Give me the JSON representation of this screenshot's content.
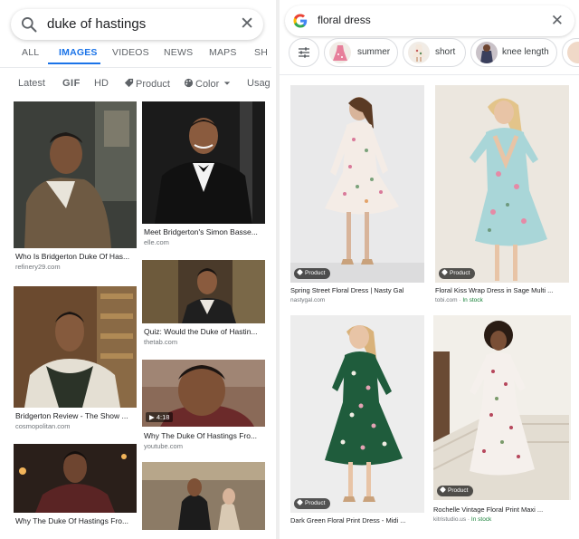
{
  "left": {
    "search": {
      "query": "duke of hastings"
    },
    "tabs": [
      {
        "label": "ALL"
      },
      {
        "label": "IMAGES"
      },
      {
        "label": "VIDEOS"
      },
      {
        "label": "NEWS"
      },
      {
        "label": "MAPS"
      },
      {
        "label": "SH"
      }
    ],
    "filters": [
      {
        "label": "Latest"
      },
      {
        "label": "GIF"
      },
      {
        "label": "HD"
      },
      {
        "label": "Product"
      },
      {
        "label": "Color"
      },
      {
        "label": "Usag"
      }
    ],
    "results": [
      {
        "title": "Who Is Bridgerton Duke Of Has...",
        "source": "refinery29.com"
      },
      {
        "title": "Meet Bridgerton's Simon Basse...",
        "source": "elle.com"
      },
      {
        "title": "Bridgerton Review - The Show ...",
        "source": "cosmopolitan.com"
      },
      {
        "title": "Quiz: Would the Duke of Hastin...",
        "source": "thetab.com"
      },
      {
        "title": "Why The Duke Of Hastings Fro...",
        "source": "youtube.com",
        "duration": "4:18"
      },
      {
        "title": "Why The Duke Of Hastings Fro..."
      }
    ]
  },
  "right": {
    "search": {
      "query": "floral dress"
    },
    "chips": [
      {
        "label": "summer"
      },
      {
        "label": "short"
      },
      {
        "label": "knee length"
      }
    ],
    "badge_label": "Product",
    "results": [
      {
        "title": "Spring Street Floral Dress | Nasty Gal",
        "source": "nastygal.com"
      },
      {
        "title": "Floral Kiss Wrap Dress in Sage Multi ...",
        "source": "tobi.com",
        "stock": "In stock"
      },
      {
        "title": "Dark Green Floral Print Dress - Midi ...",
        "source": "lulus.com"
      },
      {
        "title": "Rochelle Vintage Floral Print Maxi ...",
        "source": "kitristudio.us",
        "stock": "In stock"
      }
    ]
  },
  "colors": {
    "accent": "#1a73e8",
    "in_stock": "#188038",
    "text_primary": "#202124",
    "text_secondary": "#70757a"
  },
  "icons": [
    "search-icon",
    "close-icon",
    "play-icon",
    "tag-icon",
    "palette-icon",
    "chevron-down-icon",
    "google-logo-icon",
    "tune-icon"
  ]
}
